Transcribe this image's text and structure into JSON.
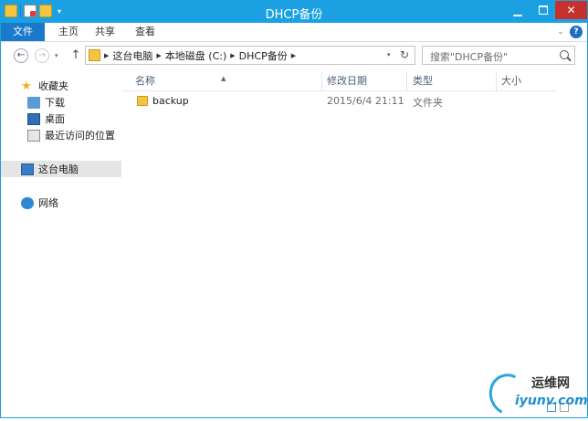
{
  "window": {
    "title": "DHCP备份",
    "controls": {
      "minimize": "▁",
      "close": "✕"
    }
  },
  "quick_access": {
    "dropdown": "▾"
  },
  "ribbon": {
    "tabs": [
      {
        "label": "文件",
        "active": true
      },
      {
        "label": "主页"
      },
      {
        "label": "共享"
      },
      {
        "label": "查看"
      }
    ],
    "expand": "⌄",
    "help": "?"
  },
  "nav": {
    "back": "←",
    "forward": "→",
    "recent": "▾",
    "up": "↑"
  },
  "address": {
    "crumbs": [
      "这台电脑",
      "本地磁盘 (C:)",
      "DHCP备份"
    ],
    "separator": "▶",
    "dropdown": "▾",
    "refresh": "↻"
  },
  "search": {
    "placeholder": "搜索\"DHCP备份\""
  },
  "nav_pane": {
    "favorites": "收藏夹",
    "downloads": "下载",
    "desktop": "桌面",
    "recent": "最近访问的位置",
    "this_pc": "这台电脑",
    "network": "网络"
  },
  "columns": {
    "name": "名称",
    "date": "修改日期",
    "type": "类型",
    "size": "大小",
    "sort": "▲"
  },
  "files": [
    {
      "name": "backup",
      "date": "2015/6/4 21:11",
      "type": "文件夹"
    }
  ],
  "watermark": {
    "brand": "运维网",
    "url": "iyunv.com"
  },
  "colors": {
    "titlebar": "#1ba1e2",
    "file_tab": "#1979ca",
    "close": "#c7312b"
  }
}
